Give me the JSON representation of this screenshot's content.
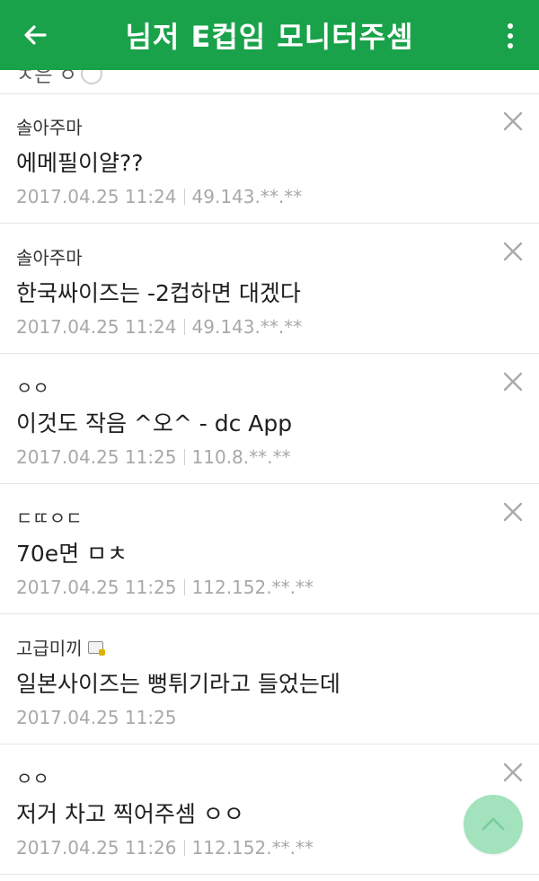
{
  "header": {
    "title": "님저 E컵임 모니터주셈",
    "back_icon": "arrow-left-icon",
    "menu_icon": "more-vert-icon",
    "bar_color": "#1aa24a"
  },
  "partial_row": {
    "text": "ㅈ은 ㅇ"
  },
  "comments": [
    {
      "author": "솔아주마",
      "body": "에메필이얄??",
      "date": "2017.04.25 11:24",
      "ip": "49.143.**.**",
      "deletable": true
    },
    {
      "author": "솔아주마",
      "body": "한국싸이즈는 -2컵하면 대겠다",
      "date": "2017.04.25 11:24",
      "ip": "49.143.**.**",
      "deletable": true
    },
    {
      "author": "ㅇㅇ",
      "body": "이것도 작음 ^오^ - dc App",
      "date": "2017.04.25 11:25",
      "ip": "110.8.**.**",
      "deletable": true
    },
    {
      "author": "ㄷㄸㅇㄷ",
      "body": "70e면 ㅁㅊ",
      "date": "2017.04.25 11:25",
      "ip": "112.152.**.**",
      "deletable": true
    },
    {
      "author": "고급미끼",
      "body": "일본사이즈는 뻥튀기라고 들었는데",
      "date": "2017.04.25 11:25",
      "ip": "",
      "deletable": false,
      "badge": "member-lock-icon"
    },
    {
      "author": "ㅇㅇ",
      "body": "저거 차고 찍어주셈 ㅇㅇ",
      "date": "2017.04.25 11:26",
      "ip": "112.152.**.**",
      "deletable": true
    }
  ],
  "fab": {
    "icon": "chevron-up-icon",
    "color": "#9be0b7"
  }
}
